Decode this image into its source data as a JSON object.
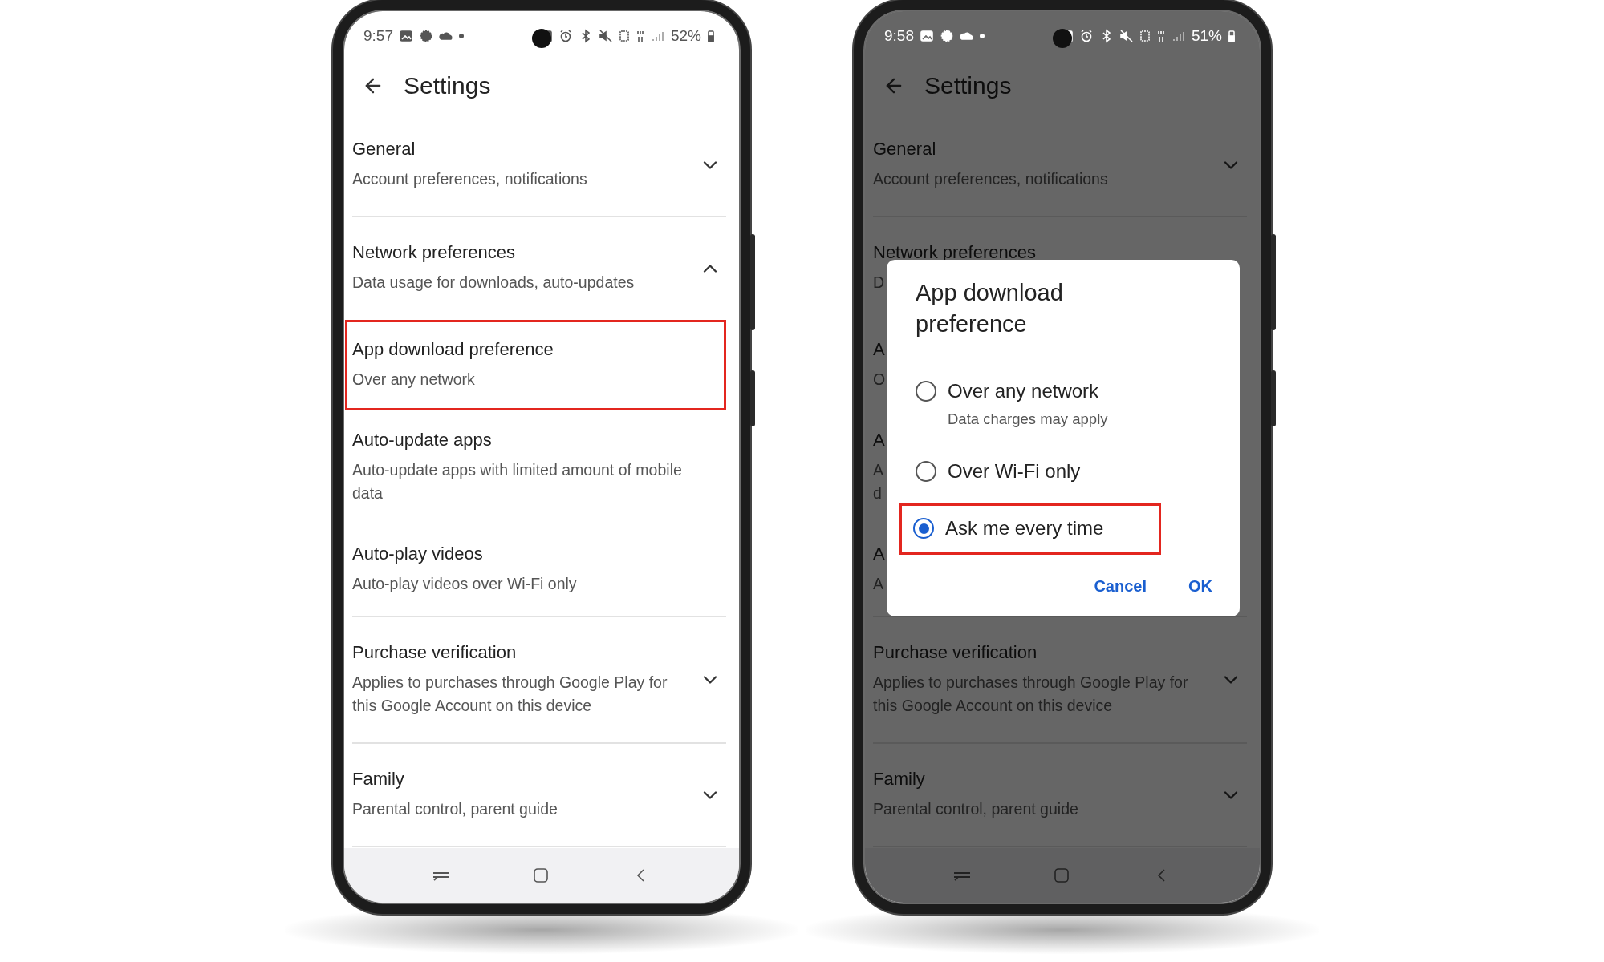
{
  "phones": [
    {
      "dimmed": false,
      "status": {
        "time": "9:57",
        "battery": "52%"
      },
      "header": {
        "title": "Settings"
      },
      "items": [
        {
          "kind": "group",
          "title": "General",
          "subtitle": "Account preferences, notifications",
          "expanded": false,
          "highlighted": false
        },
        {
          "kind": "group",
          "title": "Network preferences",
          "subtitle": "Data usage for downloads, auto-updates",
          "expanded": true,
          "highlighted": false
        },
        {
          "kind": "option",
          "title": "App download preference",
          "subtitle": "Over any network",
          "highlighted": true
        },
        {
          "kind": "option",
          "title": "Auto-update apps",
          "subtitle": "Auto-update apps with limited amount of mobile\ndata",
          "highlighted": false
        },
        {
          "kind": "option",
          "title": "Auto-play videos",
          "subtitle": "Auto-play videos over Wi-Fi only",
          "highlighted": false
        },
        {
          "kind": "group",
          "title": "Purchase verification",
          "subtitle": "Applies to purchases through Google Play for\nthis Google Account on this device",
          "expanded": false,
          "highlighted": false
        },
        {
          "kind": "group",
          "title": "Family",
          "subtitle": "Parental control, parent guide",
          "expanded": false,
          "highlighted": false
        }
      ]
    },
    {
      "dimmed": true,
      "status": {
        "time": "9:58",
        "battery": "51%"
      },
      "header": {
        "title": "Settings"
      },
      "items": [
        {
          "kind": "group",
          "title": "General",
          "subtitle": "Account preferences, notifications",
          "expanded": false,
          "highlighted": false
        },
        {
          "kind": "group",
          "title": "Network preferences",
          "subtitle": "D",
          "highlighted": false
        },
        {
          "kind": "option",
          "title": "A",
          "subtitle": "O",
          "highlighted": false
        },
        {
          "kind": "option",
          "title": "A",
          "subtitle": "A\nd",
          "highlighted": false
        },
        {
          "kind": "option",
          "title": "A",
          "subtitle": "A",
          "highlighted": false
        },
        {
          "kind": "group",
          "title": "Purchase verification",
          "subtitle": "Applies to purchases through Google Play for\nthis Google Account on this device",
          "expanded": false,
          "highlighted": false
        },
        {
          "kind": "group",
          "title": "Family",
          "subtitle": "Parental control, parent guide",
          "expanded": false,
          "highlighted": false
        }
      ],
      "dialog": {
        "title": "App download preference",
        "options": [
          {
            "label": "Over any network",
            "subtitle": "Data charges may apply",
            "selected": false,
            "highlighted": false
          },
          {
            "label": "Over Wi-Fi only",
            "selected": false,
            "highlighted": false
          },
          {
            "label": "Ask me every time",
            "selected": true,
            "highlighted": true
          }
        ],
        "buttons": [
          "Cancel",
          "OK"
        ]
      }
    }
  ]
}
